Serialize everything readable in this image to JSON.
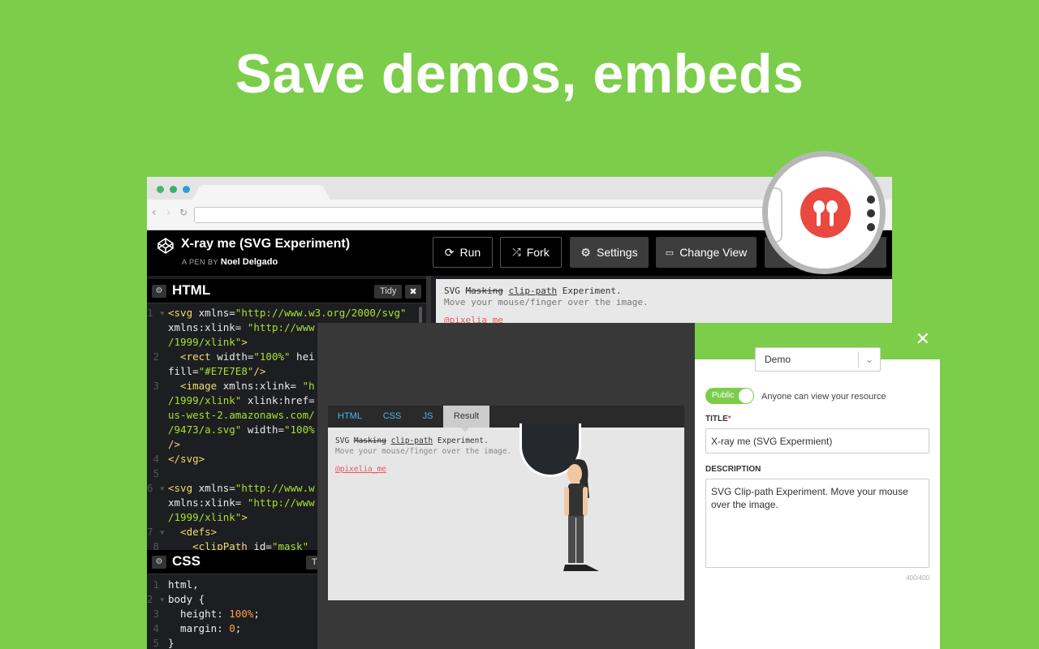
{
  "headline": "Save demos, embeds",
  "colors": {
    "background": "#7ccd4a",
    "brand": "#e9493e",
    "link": "#4ab8f2"
  },
  "browser": {
    "traffic_lights": [
      "#4db36d",
      "#36b36b",
      "#2d9fd8"
    ],
    "nav": {
      "back": "‹",
      "forward": "›",
      "reload": "↻"
    }
  },
  "codepen": {
    "title": "X-ray me (SVG Experiment)",
    "byline_prefix": "A PEN BY",
    "author": "Noel Delgado",
    "buttons": {
      "run": "Run",
      "fork": "Fork",
      "settings": "Settings",
      "change_view": "Change View"
    },
    "html_panel": {
      "title": "HTML",
      "tidy": "Tidy",
      "close": "✖",
      "lines": [
        {
          "n": "1",
          "fold": "▾",
          "parts": [
            [
              "tag",
              "<svg "
            ],
            [
              "attr",
              "xmlns="
            ],
            [
              "str",
              "\"http://www.w3.org/2000/svg\""
            ]
          ]
        },
        {
          "n": "",
          "fold": "",
          "parts": [
            [
              "attr",
              "xmlns:xlink= "
            ],
            [
              "str",
              "\"http://www"
            ]
          ]
        },
        {
          "n": "",
          "fold": "",
          "parts": [
            [
              "str",
              "/1999/xlink\""
            ],
            [
              "tag",
              ">"
            ]
          ]
        },
        {
          "n": "2",
          "fold": "",
          "parts": [
            [
              "tag",
              "  <rect "
            ],
            [
              "attr",
              "width="
            ],
            [
              "str",
              "\"100%\""
            ],
            [
              "attr",
              " hei"
            ]
          ]
        },
        {
          "n": "",
          "fold": "",
          "parts": [
            [
              "attr",
              "fill="
            ],
            [
              "str",
              "\"#E7E7E8\""
            ],
            [
              "tag",
              "/>"
            ]
          ]
        },
        {
          "n": "3",
          "fold": "",
          "parts": [
            [
              "tag",
              "  <image "
            ],
            [
              "attr",
              "xmlns:xlink= "
            ],
            [
              "str",
              "\"h"
            ]
          ]
        },
        {
          "n": "",
          "fold": "",
          "parts": [
            [
              "str",
              "/1999/xlink\""
            ],
            [
              "attr",
              " xlink:href="
            ]
          ]
        },
        {
          "n": "",
          "fold": "",
          "parts": [
            [
              "str",
              "us-west-2.amazonaws.com/"
            ]
          ]
        },
        {
          "n": "",
          "fold": "",
          "parts": [
            [
              "str",
              "/9473/a.svg\""
            ],
            [
              "attr",
              " width="
            ],
            [
              "str",
              "\"100%"
            ]
          ]
        },
        {
          "n": "",
          "fold": "",
          "parts": [
            [
              "tag",
              "/>"
            ]
          ]
        },
        {
          "n": "4",
          "fold": "",
          "parts": [
            [
              "tag",
              "</svg>"
            ]
          ]
        },
        {
          "n": "5",
          "fold": "",
          "parts": []
        },
        {
          "n": "6",
          "fold": "▾",
          "parts": [
            [
              "tag",
              "<svg "
            ],
            [
              "attr",
              "xmlns="
            ],
            [
              "str",
              "\"http://www.w"
            ]
          ]
        },
        {
          "n": "",
          "fold": "",
          "parts": [
            [
              "attr",
              "xmlns:xlink= "
            ],
            [
              "str",
              "\"http://www"
            ]
          ]
        },
        {
          "n": "",
          "fold": "",
          "parts": [
            [
              "str",
              "/1999/xlink\""
            ],
            [
              "tag",
              ">"
            ]
          ]
        },
        {
          "n": "7",
          "fold": "▾",
          "parts": [
            [
              "tag",
              "  <defs>"
            ]
          ]
        },
        {
          "n": "8",
          "fold": "",
          "parts": [
            [
              "tag",
              "    <clipPath "
            ],
            [
              "attr",
              "id="
            ],
            [
              "str",
              "\"mask\""
            ]
          ]
        }
      ]
    },
    "css_panel": {
      "title": "CSS",
      "tidy": "Ti",
      "lines": [
        {
          "n": "1",
          "fold": "",
          "parts": [
            [
              "prop",
              "html,"
            ]
          ]
        },
        {
          "n": "2",
          "fold": "▾",
          "parts": [
            [
              "prop",
              "body {"
            ]
          ]
        },
        {
          "n": "3",
          "fold": "",
          "parts": [
            [
              "prop",
              "  height: "
            ],
            [
              "num",
              "100%"
            ],
            [
              "prop",
              ";"
            ]
          ]
        },
        {
          "n": "4",
          "fold": "",
          "parts": [
            [
              "prop",
              "  margin: "
            ],
            [
              "num",
              "0"
            ],
            [
              "prop",
              ";"
            ]
          ]
        },
        {
          "n": "5",
          "fold": "",
          "parts": [
            [
              "prop",
              "}"
            ]
          ]
        }
      ]
    },
    "preview": {
      "line1_pre": "SVG ",
      "line1_strike": "Masking",
      "line1_link": "clip-path",
      "line1_post": " Experiment.",
      "line2": "Move your mouse/finger over the image.",
      "handle": "@pixelia_me"
    }
  },
  "demo_modal": {
    "tabs": [
      "HTML",
      "CSS",
      "JS",
      "Result"
    ],
    "active_tab": "Result",
    "text_pre": "SVG ",
    "text_strike": "Masking",
    "text_link": "clip-path",
    "text_post": " Experiment.",
    "text_line2": "Move your mouse/finger over the image.",
    "handle": "@pixelia_me"
  },
  "save_panel": {
    "close": "✕",
    "type_select": "Demo",
    "select_arrow": "⌄",
    "toggle_label": "Public",
    "toggle_description": "Anyone can view your resource",
    "title_label": "TITLE",
    "title_required": "*",
    "title_value": "X-ray me (SVG Expermient)",
    "description_label": "DESCRIPTION",
    "description_value": "SVG Clip-path Experiment. Move your mouse over the image.",
    "char_counter": "400/400"
  }
}
